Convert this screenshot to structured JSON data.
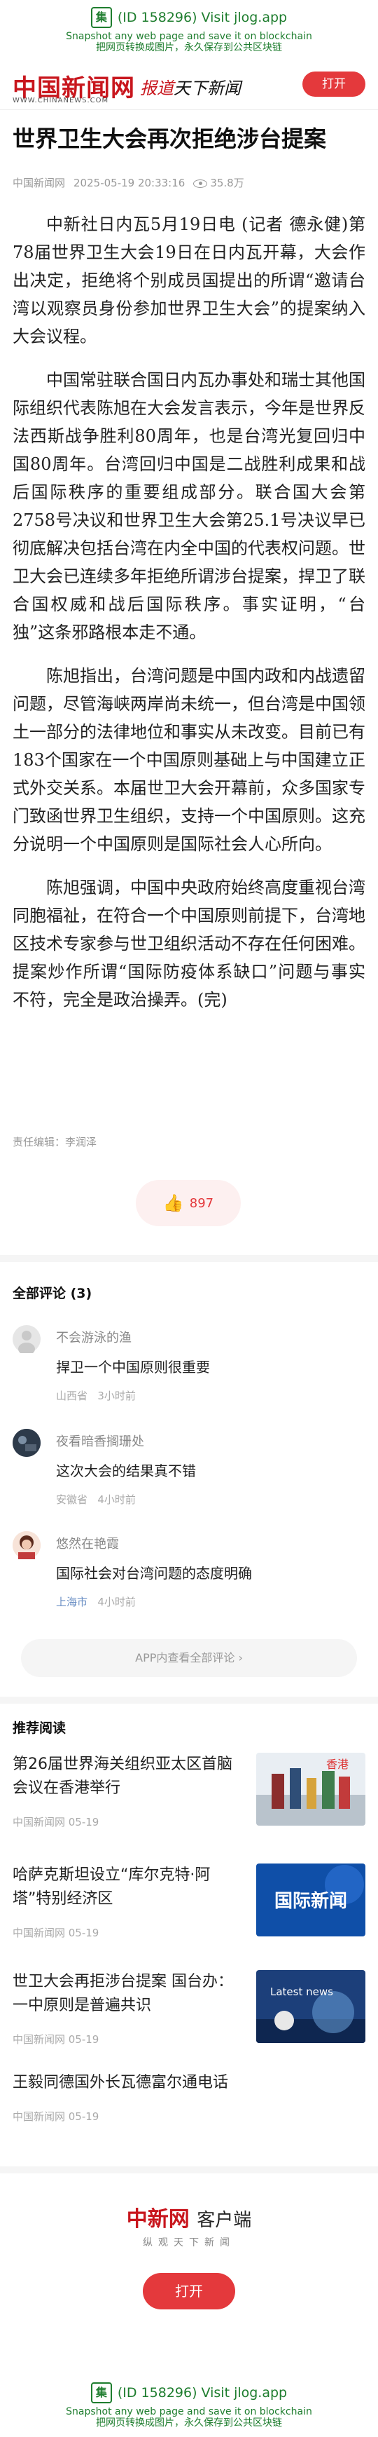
{
  "watermark": {
    "badge": "集",
    "line1": "(ID 158296) Visit jlog.app",
    "line2": "Snapshot any web page and save it on blockchain",
    "line3": "把网页转换成图片，永久保存到公共区块链"
  },
  "header": {
    "logo": "中国新闻网",
    "logo_url": "WWW.CHINANEWS.COM",
    "slogan_red": "报道",
    "slogan_dark": "天下新闻",
    "open_label": "打开"
  },
  "article": {
    "title": "世界卫生大会再次拒绝涉台提案",
    "source": "中国新闻网",
    "datetime": "2025-05-19 20:33:16",
    "views": "35.8万",
    "paragraphs": [
      "中新社日内瓦5月19日电 (记者 德永健)第78届世界卫生大会19日在日内瓦开幕，大会作出决定，拒绝将个别成员国提出的所谓“邀请台湾以观察员身份参加世界卫生大会”的提案纳入大会议程。",
      "中国常驻联合国日内瓦办事处和瑞士其他国际组织代表陈旭在大会发言表示，今年是世界反法西斯战争胜利80周年，也是台湾光复回归中国80周年。台湾回归中国是二战胜利成果和战后国际秩序的重要组成部分。联合国大会第2758号决议和世界卫生大会第25.1号决议早已彻底解决包括台湾在内全中国的代表权问题。世卫大会已连续多年拒绝所谓涉台提案，捍卫了联合国权威和战后国际秩序。事实证明，“台独”这条邪路根本走不通。",
      "陈旭指出，台湾问题是中国内政和内战遗留问题，尽管海峡两岸尚未统一，但台湾是中国领土一部分的法律地位和事实从未改变。目前已有183个国家在一个中国原则基础上与中国建立正式外交关系。本届世卫大会开幕前，众多国家专门致函世界卫生组织，支持一个中国原则。这充分说明一个中国原则是国际社会人心所向。",
      "陈旭强调，中国中央政府始终高度重视台湾同胞福祉，在符合一个中国原则前提下，台湾地区技术专家参与世卫组织活动不存在任何困难。提案炒作所谓“国际防疫体系缺口”问题与事实不符，完全是政治操弄。(完)"
    ],
    "editor": "责任编辑：李润泽",
    "likes": "897"
  },
  "comments": {
    "heading": "全部评论 (3)",
    "items": [
      {
        "name": "不会游泳的渔",
        "text": "捍卫一个中国原则很重要",
        "location": "山西省",
        "time": "3小时前"
      },
      {
        "name": "夜看暗香搁珊处",
        "text": "这次大会的结果真不错",
        "location": "安徽省",
        "time": "4小时前"
      },
      {
        "name": "悠然在艳霞",
        "text": "国际社会对台湾问题的态度明确",
        "location": "上海市",
        "time": "4小时前"
      }
    ],
    "more_label": "APP内查看全部评论 ›"
  },
  "recommend": {
    "heading": "推荐阅读",
    "items": [
      {
        "title": "第26届世界海关组织亚太区首脑会议在香港举行",
        "source": "中国新闻网 05-19",
        "thumb_caption": "香港"
      },
      {
        "title": "哈萨克斯坦设立“库尔克特·阿塔”特别经济区",
        "source": "中国新闻网 05-19",
        "thumb_caption": "国际新闻"
      },
      {
        "title": "世卫大会再拒涉台提案 国台办：一中原则是普遍共识",
        "source": "中国新闻网 05-19",
        "thumb_caption": "Latest news"
      },
      {
        "title": "王毅同德国外长瓦德富尔通电话",
        "source": "中国新闻网 05-19"
      }
    ]
  },
  "footer": {
    "logo": "中新网",
    "client": "客户端",
    "tagline": "纵观天下新闻",
    "open_label": "打开"
  },
  "colors": {
    "brand_red": "#c8161d",
    "button_red": "#e4393c",
    "watermark_green": "#1e7d2e"
  }
}
